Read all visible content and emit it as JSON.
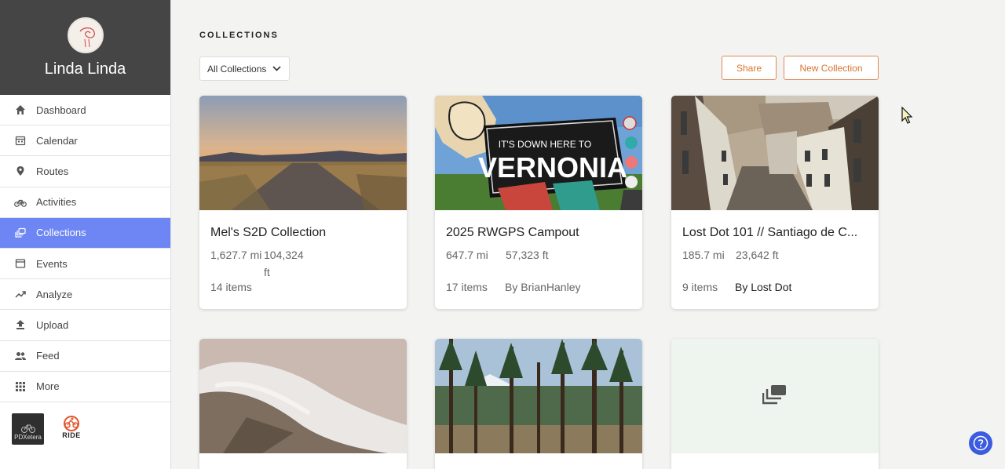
{
  "user": {
    "name": "Linda Linda"
  },
  "nav": [
    {
      "label": "Dashboard",
      "icon": "home-icon"
    },
    {
      "label": "Calendar",
      "icon": "calendar-icon"
    },
    {
      "label": "Routes",
      "icon": "map-pin-icon"
    },
    {
      "label": "Activities",
      "icon": "bicycle-icon"
    },
    {
      "label": "Collections",
      "icon": "collections-icon",
      "active": true
    },
    {
      "label": "Events",
      "icon": "events-icon"
    },
    {
      "label": "Analyze",
      "icon": "trend-icon"
    },
    {
      "label": "Upload",
      "icon": "upload-icon"
    },
    {
      "label": "Feed",
      "icon": "people-icon"
    },
    {
      "label": "More",
      "icon": "grid-icon"
    }
  ],
  "clubs": [
    {
      "label": "PDXetera"
    },
    {
      "label": "RIDE"
    }
  ],
  "page": {
    "title": "COLLECTIONS"
  },
  "filter": {
    "selected": "All Collections"
  },
  "actions": {
    "share": "Share",
    "new_collection": "New Collection"
  },
  "collections": [
    {
      "title": "Mel's S2D Collection",
      "distance": "1,627.7 mi",
      "elevation": "104,324 ft",
      "items": "14 items",
      "by": ""
    },
    {
      "title": "2025 RWGPS Campout",
      "distance": "647.7 mi",
      "elevation": "57,323 ft",
      "items": "17 items",
      "by": "By BrianHanley"
    },
    {
      "title": "Lost Dot 101 // Santiago de C...",
      "distance": "185.7 mi",
      "elevation": "23,642 ft",
      "items": "9 items",
      "by": "By Lost Dot"
    }
  ],
  "colors": {
    "accent": "#6d86f3",
    "brand_orange": "#d9742e",
    "sidebar_header": "#454545",
    "help": "#3b5be0"
  }
}
